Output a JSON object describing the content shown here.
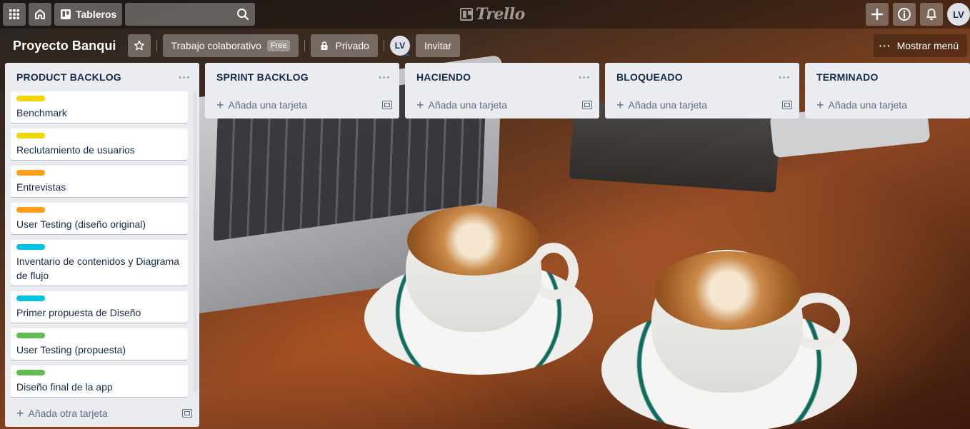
{
  "header": {
    "boards_label": "Tableros",
    "logo_text": "Trello",
    "avatar_initials": "LV"
  },
  "board": {
    "title": "Proyecto Banqui",
    "workspace_label": "Trabajo colaborativo",
    "workspace_badge": "Free",
    "visibility_label": "Privado",
    "member_initials": "LV",
    "invite_label": "Invitar",
    "show_menu_label": "Mostrar menú"
  },
  "colors": {
    "yellow": "#f2d600",
    "orange": "#ff9f1a",
    "sky": "#00c2e0",
    "green": "#61bd4f"
  },
  "lists": [
    {
      "title": "PRODUCT BACKLOG",
      "add_label": "Añada otra tarjeta",
      "cards": [
        {
          "title": "Benchmark",
          "label_color": "yellow"
        },
        {
          "title": "Reclutamiento de usuarios",
          "label_color": "yellow"
        },
        {
          "title": "Entrevistas",
          "label_color": "orange"
        },
        {
          "title": "User Testing (diseño original)",
          "label_color": "orange"
        },
        {
          "title": "Inventario de contenidos y Diagrama de flujo",
          "label_color": "sky"
        },
        {
          "title": "Primer propuesta de Diseño",
          "label_color": "sky"
        },
        {
          "title": "User Testing (propuesta)",
          "label_color": "green"
        },
        {
          "title": "Diseño final de la app",
          "label_color": "green"
        }
      ]
    },
    {
      "title": "SPRINT BACKLOG",
      "add_label": "Añada una tarjeta",
      "cards": []
    },
    {
      "title": "HACIENDO",
      "add_label": "Añada una tarjeta",
      "cards": []
    },
    {
      "title": "BLOQUEADO",
      "add_label": "Añada una tarjeta",
      "cards": []
    },
    {
      "title": "TERMINADO",
      "add_label": "Añada una tarjeta",
      "cards": []
    }
  ]
}
